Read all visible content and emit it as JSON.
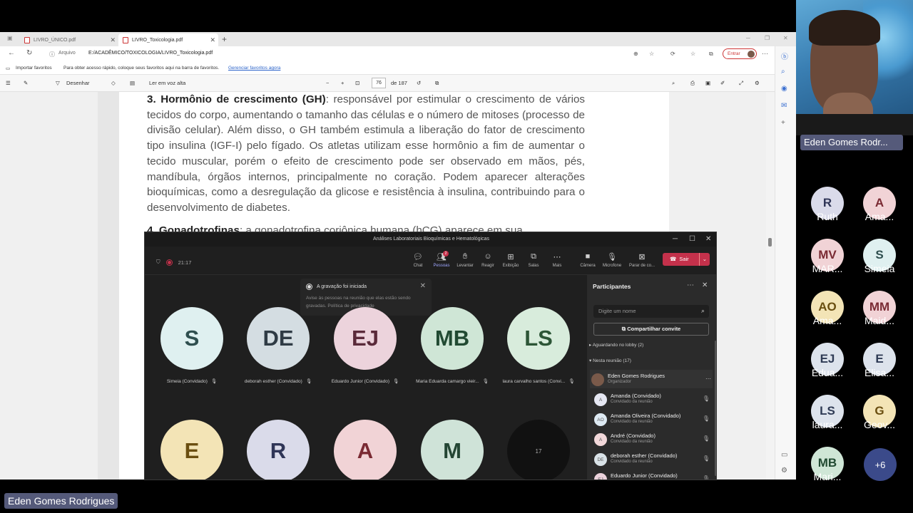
{
  "browser": {
    "tabs": [
      {
        "label": "LIVRO_ÚNICO.pdf"
      },
      {
        "label": "LIVRO_Toxicologia.pdf"
      }
    ],
    "address_label": "Arquivo",
    "url": "E:/ACADÊMICO/TOXICOLOGIA/LIVRO_Toxicologia.pdf",
    "entrar": "Entrar",
    "favorites": {
      "import": "Importar favoritos",
      "hint": "Para obter acesso rápido, coloque seus favoritos aqui na barra de favoritos.",
      "manage_link": "Gerenciar favoritos agora"
    }
  },
  "pdf_toolbar": {
    "draw": "Desenhar",
    "read_aloud": "Ler em voz alta",
    "zoom_out": "−",
    "zoom_in": "+",
    "page_current": "76",
    "page_total": "de 187"
  },
  "pdf": {
    "para3_heading": "3. Hormônio de crescimento (GH)",
    "para3_body": ": responsável por estimular o crescimento de vários tecidos do corpo, aumentando o tamanho das células e o número de mitoses (processo de divisão celular). Além disso, o GH também estimula a liberação do fator de crescimento tipo insulina (IGF-I) pelo fígado. Os atletas utilizam esse hormônio a fim de aumentar o tecido muscular, porém o efeito de crescimento pode ser observado em mãos, pés, mandíbula, órgãos internos, principalmente no coração. Podem aparecer alterações bioquímicas, como a desregulação da glicose e resistência à insulina, contribuindo para o desenvolvimento de diabetes.",
    "para4_heading": "4. Gonadotrofinas",
    "para4_body": ": a gonadotrofina coriônica humana (hCG) aparece em sua"
  },
  "teams": {
    "window_title": "Análises Laboratoriais Bioquímicas e Hematológicas",
    "timer": "21:17",
    "toolbar": [
      {
        "label": "Chat",
        "icon": "chat-icon"
      },
      {
        "label": "Pessoas",
        "icon": "people-icon",
        "badge": "2"
      },
      {
        "label": "Levantar",
        "icon": "hand-icon"
      },
      {
        "label": "Reagir",
        "icon": "smile-icon"
      },
      {
        "label": "Exibição",
        "icon": "grid-icon"
      },
      {
        "label": "Salas",
        "icon": "rooms-icon"
      },
      {
        "label": "Mais",
        "icon": "more-icon"
      },
      {
        "label": "Câmera",
        "icon": "camera-icon"
      },
      {
        "label": "Microfone",
        "icon": "mic-icon"
      },
      {
        "label": "Parar de co...",
        "icon": "stop-share-icon"
      }
    ],
    "leave": "Sair",
    "toast": {
      "title": "A gravação foi iniciada",
      "body": "Avise às pessoas na reunião que elas estão sendo gravadas. Política de privacidade"
    },
    "tiles": [
      {
        "initials": "S",
        "name": "Simeia (Convidado)",
        "bg": "#dff0f0",
        "fg": "#2f4f4f"
      },
      {
        "initials": "DE",
        "name": "deborah esther (Convidado)",
        "bg": "#d4dde2",
        "fg": "#2f3b45"
      },
      {
        "initials": "EJ",
        "name": "Eduardo Junior (Convidado)",
        "bg": "#ecd3dc",
        "fg": "#5a2a3a"
      },
      {
        "initials": "MB",
        "name": "Maria Eduarda camargo vieir...",
        "bg": "#cfe6d6",
        "fg": "#214a32"
      },
      {
        "initials": "LS",
        "name": "laura carvalho santos (Convi...",
        "bg": "#d8ecdc",
        "fg": "#2c5536"
      },
      {
        "initials": "E",
        "name": "",
        "bg": "#f3e4b6",
        "fg": "#6a4e10"
      },
      {
        "initials": "R",
        "name": "",
        "bg": "#dadbea",
        "fg": "#2f3557"
      },
      {
        "initials": "A",
        "name": "",
        "bg": "#f1d3d6",
        "fg": "#7a2a33"
      },
      {
        "initials": "M",
        "name": "",
        "bg": "#cfe3d8",
        "fg": "#244634"
      }
    ],
    "more_count": "17",
    "panel": {
      "title": "Participantes",
      "search_placeholder": "Digite um nome",
      "share": "Compartilhar convite",
      "lobby": "Aguardando no lobby (2)",
      "in_meeting": "Nesta reunião (17)",
      "people": [
        {
          "initials": "",
          "name": "Eden Gomes Rodrigues",
          "role": "Organizador",
          "bg": "#7a5a4a"
        },
        {
          "initials": "A",
          "name": "Amanda (Convidado)",
          "role": "Convidado da reunião",
          "bg": "#e5e7f2"
        },
        {
          "initials": "AO",
          "name": "Amanda Oliveira (Convidado)",
          "role": "Convidado da reunião",
          "bg": "#dde9f2"
        },
        {
          "initials": "A",
          "name": "André (Convidado)",
          "role": "Convidado da reunião",
          "bg": "#f2d8da"
        },
        {
          "initials": "DE",
          "name": "deborah esther (Convidado)",
          "role": "Convidado da reunião",
          "bg": "#d9e2e7"
        },
        {
          "initials": "EJ",
          "name": "Eduardo Junior (Convidado)",
          "role": "",
          "bg": "#ecd3dc"
        }
      ]
    }
  },
  "camera": {
    "name": "Eden Gomes Rodr..."
  },
  "participants_strip": [
    {
      "initials": "R",
      "name": "Ruth",
      "bg": "#dadbea",
      "fg": "#2f3557"
    },
    {
      "initials": "A",
      "name": "Ama...",
      "bg": "#f1d3d6",
      "fg": "#7a2a33"
    },
    {
      "initials": "MV",
      "name": "MAR...",
      "bg": "#f1d3d6",
      "fg": "#7a2a33"
    },
    {
      "initials": "S",
      "name": "Simeia",
      "bg": "#dff0f0",
      "fg": "#2f4f4f"
    },
    {
      "initials": "AO",
      "name": "Ama...",
      "bg": "#f3e4b6",
      "fg": "#6a4e10"
    },
    {
      "initials": "MM",
      "name": "Maid...",
      "bg": "#f1d3d6",
      "fg": "#7a2a33"
    },
    {
      "initials": "EJ",
      "name": "Edua...",
      "bg": "#dde3ec",
      "fg": "#2f3b55"
    },
    {
      "initials": "E",
      "name": "Elisa...",
      "bg": "#dde3ec",
      "fg": "#2f3b55"
    },
    {
      "initials": "LS",
      "name": "laura...",
      "bg": "#dde3ec",
      "fg": "#2f3b55"
    },
    {
      "initials": "G",
      "name": "Geov...",
      "bg": "#f3e4b6",
      "fg": "#6a4e10"
    },
    {
      "initials": "MB",
      "name": "Mari...",
      "bg": "#cfe6d6",
      "fg": "#214a32"
    }
  ],
  "more_strip": "+6",
  "presenter_label": "Eden Gomes Rodrigues"
}
